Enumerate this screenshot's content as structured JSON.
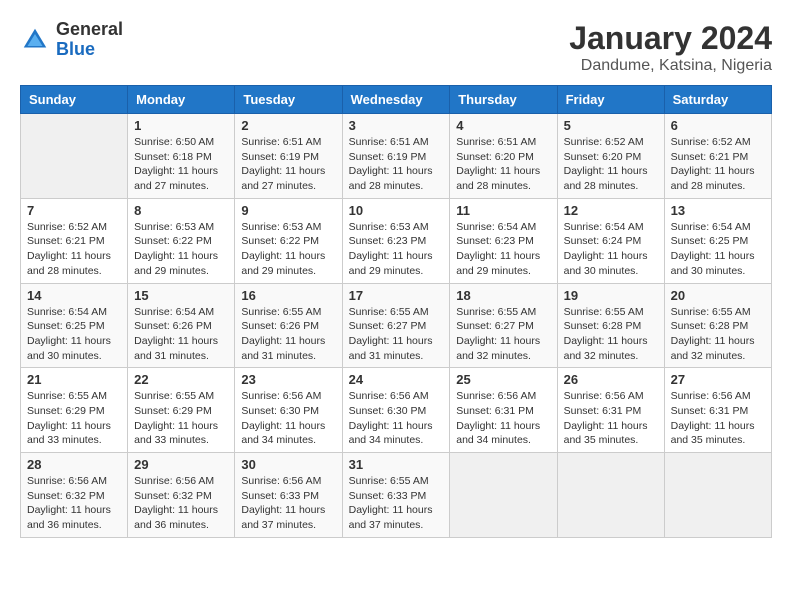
{
  "logo": {
    "general": "General",
    "blue": "Blue"
  },
  "header": {
    "title": "January 2024",
    "subtitle": "Dandume, Katsina, Nigeria"
  },
  "calendar": {
    "weekdays": [
      "Sunday",
      "Monday",
      "Tuesday",
      "Wednesday",
      "Thursday",
      "Friday",
      "Saturday"
    ],
    "rows": [
      [
        {
          "day": "",
          "sunrise": "",
          "sunset": "",
          "daylight": ""
        },
        {
          "day": "1",
          "sunrise": "Sunrise: 6:50 AM",
          "sunset": "Sunset: 6:18 PM",
          "daylight": "Daylight: 11 hours and 27 minutes."
        },
        {
          "day": "2",
          "sunrise": "Sunrise: 6:51 AM",
          "sunset": "Sunset: 6:19 PM",
          "daylight": "Daylight: 11 hours and 27 minutes."
        },
        {
          "day": "3",
          "sunrise": "Sunrise: 6:51 AM",
          "sunset": "Sunset: 6:19 PM",
          "daylight": "Daylight: 11 hours and 28 minutes."
        },
        {
          "day": "4",
          "sunrise": "Sunrise: 6:51 AM",
          "sunset": "Sunset: 6:20 PM",
          "daylight": "Daylight: 11 hours and 28 minutes."
        },
        {
          "day": "5",
          "sunrise": "Sunrise: 6:52 AM",
          "sunset": "Sunset: 6:20 PM",
          "daylight": "Daylight: 11 hours and 28 minutes."
        },
        {
          "day": "6",
          "sunrise": "Sunrise: 6:52 AM",
          "sunset": "Sunset: 6:21 PM",
          "daylight": "Daylight: 11 hours and 28 minutes."
        }
      ],
      [
        {
          "day": "7",
          "sunrise": "Sunrise: 6:52 AM",
          "sunset": "Sunset: 6:21 PM",
          "daylight": "Daylight: 11 hours and 28 minutes."
        },
        {
          "day": "8",
          "sunrise": "Sunrise: 6:53 AM",
          "sunset": "Sunset: 6:22 PM",
          "daylight": "Daylight: 11 hours and 29 minutes."
        },
        {
          "day": "9",
          "sunrise": "Sunrise: 6:53 AM",
          "sunset": "Sunset: 6:22 PM",
          "daylight": "Daylight: 11 hours and 29 minutes."
        },
        {
          "day": "10",
          "sunrise": "Sunrise: 6:53 AM",
          "sunset": "Sunset: 6:23 PM",
          "daylight": "Daylight: 11 hours and 29 minutes."
        },
        {
          "day": "11",
          "sunrise": "Sunrise: 6:54 AM",
          "sunset": "Sunset: 6:23 PM",
          "daylight": "Daylight: 11 hours and 29 minutes."
        },
        {
          "day": "12",
          "sunrise": "Sunrise: 6:54 AM",
          "sunset": "Sunset: 6:24 PM",
          "daylight": "Daylight: 11 hours and 30 minutes."
        },
        {
          "day": "13",
          "sunrise": "Sunrise: 6:54 AM",
          "sunset": "Sunset: 6:25 PM",
          "daylight": "Daylight: 11 hours and 30 minutes."
        }
      ],
      [
        {
          "day": "14",
          "sunrise": "Sunrise: 6:54 AM",
          "sunset": "Sunset: 6:25 PM",
          "daylight": "Daylight: 11 hours and 30 minutes."
        },
        {
          "day": "15",
          "sunrise": "Sunrise: 6:54 AM",
          "sunset": "Sunset: 6:26 PM",
          "daylight": "Daylight: 11 hours and 31 minutes."
        },
        {
          "day": "16",
          "sunrise": "Sunrise: 6:55 AM",
          "sunset": "Sunset: 6:26 PM",
          "daylight": "Daylight: 11 hours and 31 minutes."
        },
        {
          "day": "17",
          "sunrise": "Sunrise: 6:55 AM",
          "sunset": "Sunset: 6:27 PM",
          "daylight": "Daylight: 11 hours and 31 minutes."
        },
        {
          "day": "18",
          "sunrise": "Sunrise: 6:55 AM",
          "sunset": "Sunset: 6:27 PM",
          "daylight": "Daylight: 11 hours and 32 minutes."
        },
        {
          "day": "19",
          "sunrise": "Sunrise: 6:55 AM",
          "sunset": "Sunset: 6:28 PM",
          "daylight": "Daylight: 11 hours and 32 minutes."
        },
        {
          "day": "20",
          "sunrise": "Sunrise: 6:55 AM",
          "sunset": "Sunset: 6:28 PM",
          "daylight": "Daylight: 11 hours and 32 minutes."
        }
      ],
      [
        {
          "day": "21",
          "sunrise": "Sunrise: 6:55 AM",
          "sunset": "Sunset: 6:29 PM",
          "daylight": "Daylight: 11 hours and 33 minutes."
        },
        {
          "day": "22",
          "sunrise": "Sunrise: 6:55 AM",
          "sunset": "Sunset: 6:29 PM",
          "daylight": "Daylight: 11 hours and 33 minutes."
        },
        {
          "day": "23",
          "sunrise": "Sunrise: 6:56 AM",
          "sunset": "Sunset: 6:30 PM",
          "daylight": "Daylight: 11 hours and 34 minutes."
        },
        {
          "day": "24",
          "sunrise": "Sunrise: 6:56 AM",
          "sunset": "Sunset: 6:30 PM",
          "daylight": "Daylight: 11 hours and 34 minutes."
        },
        {
          "day": "25",
          "sunrise": "Sunrise: 6:56 AM",
          "sunset": "Sunset: 6:31 PM",
          "daylight": "Daylight: 11 hours and 34 minutes."
        },
        {
          "day": "26",
          "sunrise": "Sunrise: 6:56 AM",
          "sunset": "Sunset: 6:31 PM",
          "daylight": "Daylight: 11 hours and 35 minutes."
        },
        {
          "day": "27",
          "sunrise": "Sunrise: 6:56 AM",
          "sunset": "Sunset: 6:31 PM",
          "daylight": "Daylight: 11 hours and 35 minutes."
        }
      ],
      [
        {
          "day": "28",
          "sunrise": "Sunrise: 6:56 AM",
          "sunset": "Sunset: 6:32 PM",
          "daylight": "Daylight: 11 hours and 36 minutes."
        },
        {
          "day": "29",
          "sunrise": "Sunrise: 6:56 AM",
          "sunset": "Sunset: 6:32 PM",
          "daylight": "Daylight: 11 hours and 36 minutes."
        },
        {
          "day": "30",
          "sunrise": "Sunrise: 6:56 AM",
          "sunset": "Sunset: 6:33 PM",
          "daylight": "Daylight: 11 hours and 37 minutes."
        },
        {
          "day": "31",
          "sunrise": "Sunrise: 6:55 AM",
          "sunset": "Sunset: 6:33 PM",
          "daylight": "Daylight: 11 hours and 37 minutes."
        },
        {
          "day": "",
          "sunrise": "",
          "sunset": "",
          "daylight": ""
        },
        {
          "day": "",
          "sunrise": "",
          "sunset": "",
          "daylight": ""
        },
        {
          "day": "",
          "sunrise": "",
          "sunset": "",
          "daylight": ""
        }
      ]
    ]
  }
}
